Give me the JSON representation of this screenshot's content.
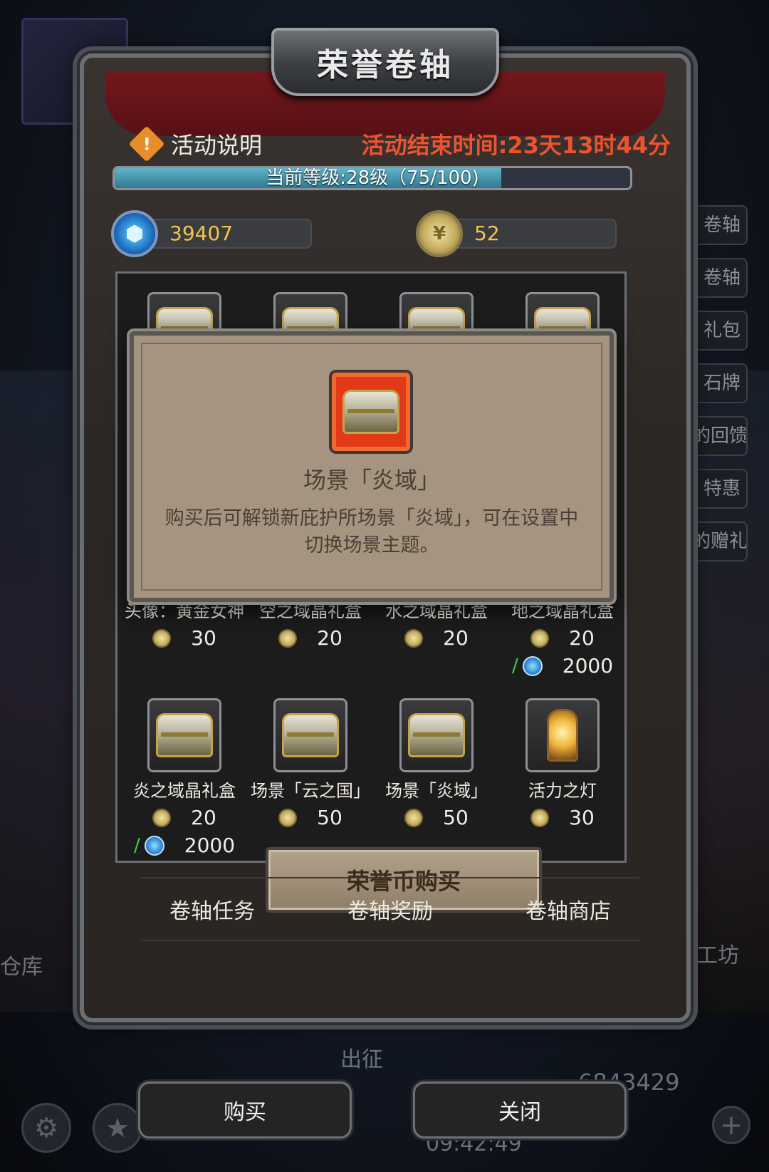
{
  "dialog": {
    "title": "荣誉卷轴",
    "info_label": "活动说明",
    "end_time": "活动结束时间:23天13时44分",
    "level_text": "当前等级:28级（75/100)",
    "level_progress": 0.75
  },
  "currency": {
    "gems": "39407",
    "honor_coins": "52"
  },
  "shop": {
    "row2": [
      {
        "name": "头像：黄金女神",
        "price": "30",
        "alt_price": ""
      },
      {
        "name": "空之域晶礼盒",
        "price": "20",
        "alt_price": ""
      },
      {
        "name": "水之域晶礼盒",
        "price": "20",
        "alt_price": ""
      },
      {
        "name": "地之域晶礼盒",
        "price": "20",
        "alt_price": "2000"
      }
    ],
    "row3": [
      {
        "name": "炎之域晶礼盒",
        "price": "20",
        "alt_price": "2000"
      },
      {
        "name": "场景「云之国」",
        "price": "50",
        "alt_price": ""
      },
      {
        "name": "场景「炎域」",
        "price": "50",
        "alt_price": ""
      },
      {
        "name": "活力之灯",
        "price": "30",
        "alt_price": ""
      }
    ],
    "buy_with_honor": "荣誉币购买"
  },
  "tabs": [
    "卷轴任务",
    "卷轴奖励",
    "卷轴商店"
  ],
  "popup": {
    "title": "场景「炎域」",
    "description": "购买后可解锁新庇护所场景「炎域」，可在设置中切换场景主题。"
  },
  "bottom": {
    "buy_label": "购买",
    "close_label": "关闭",
    "clock": "09:42:49",
    "bg_score": "6843429"
  },
  "background": {
    "side_buttons": [
      "卷轴",
      "卷轴",
      "礼包",
      "石牌",
      "的回馈",
      "特惠",
      "的赠礼"
    ],
    "left_label": "仓库",
    "right_label": "工坊",
    "center_label": "出征"
  }
}
